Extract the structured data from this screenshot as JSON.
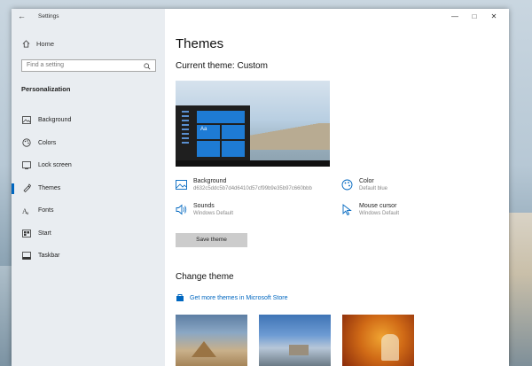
{
  "window": {
    "title": "Settings",
    "back_glyph": "←",
    "controls": {
      "minimize": "—",
      "maximize": "□",
      "close": "✕"
    }
  },
  "sidebar": {
    "home_label": "Home",
    "search_placeholder": "Find a setting",
    "section_title": "Personalization",
    "items": [
      {
        "label": "Background",
        "icon": "picture-icon"
      },
      {
        "label": "Colors",
        "icon": "palette-icon"
      },
      {
        "label": "Lock screen",
        "icon": "lock-screen-icon"
      },
      {
        "label": "Themes",
        "icon": "brush-icon",
        "active": true
      },
      {
        "label": "Fonts",
        "icon": "font-icon"
      },
      {
        "label": "Start",
        "icon": "start-icon"
      },
      {
        "label": "Taskbar",
        "icon": "taskbar-icon"
      }
    ]
  },
  "main": {
    "title": "Themes",
    "current_theme": "Current theme: Custom",
    "preview_text": "Aa",
    "settings": {
      "background": {
        "label": "Background",
        "value": "d632c5ddc5b7d4d6410d57cf99b9e35b97c660bbb"
      },
      "color": {
        "label": "Color",
        "value": "Default blue"
      },
      "sounds": {
        "label": "Sounds",
        "value": "Windows Default"
      },
      "cursor": {
        "label": "Mouse cursor",
        "value": "Windows Default"
      }
    },
    "save_button": "Save theme",
    "change_theme_title": "Change theme",
    "store_link": "Get more themes in Microsoft Store"
  },
  "colors": {
    "accent": "#0067c0",
    "sidebar_bg": "#e9edf1"
  }
}
